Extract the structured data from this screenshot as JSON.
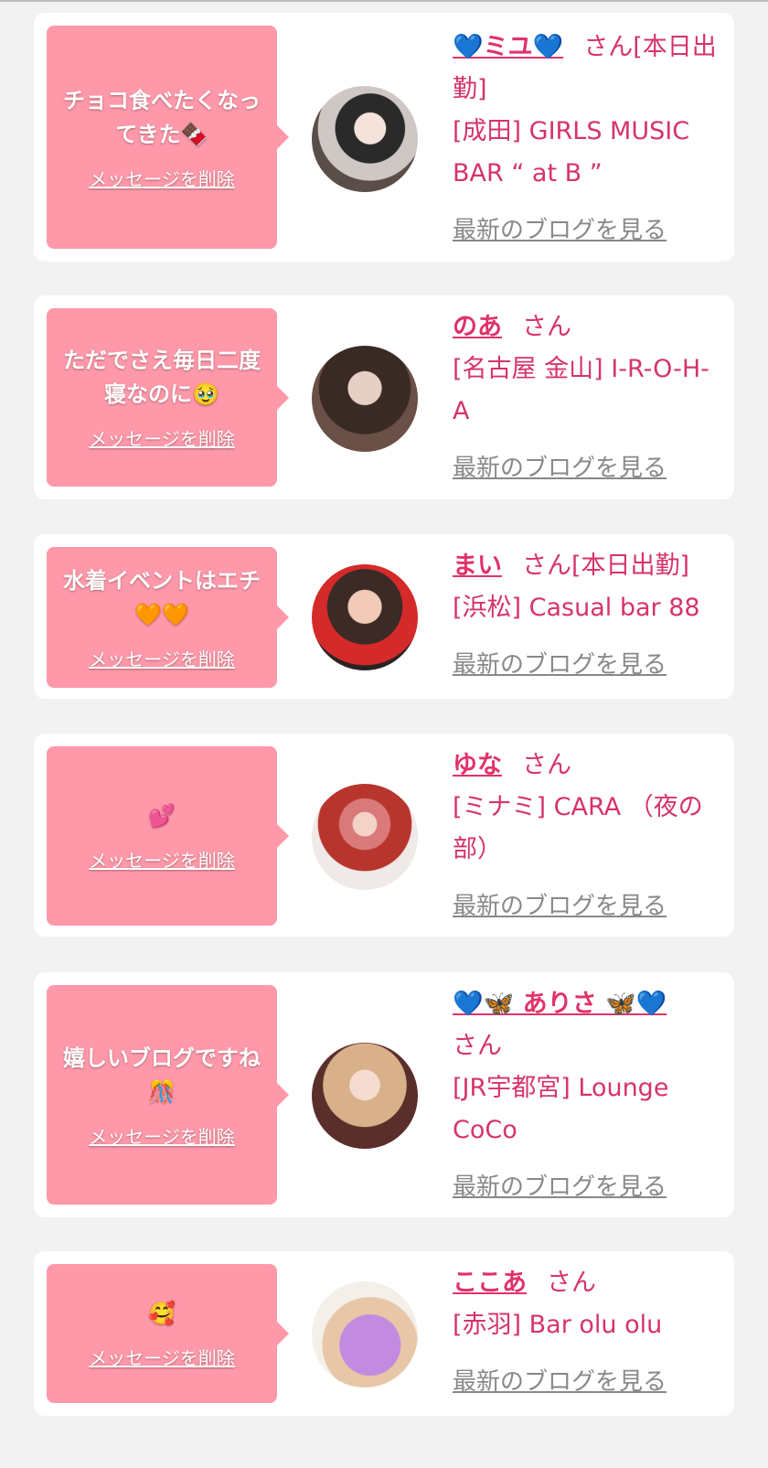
{
  "delete_label": "メッセージを削除",
  "blog_label": "最新のブログを見る",
  "san_label": "さん",
  "cards": [
    {
      "message": "チョコ食べたくなってきた🍫",
      "name": "💙ミユ💙",
      "status": "[本日出勤]",
      "shop": "[成田] GIRLS MUSIC BAR “ at B ”"
    },
    {
      "message": "ただでさえ毎日二度寝なのに🥹",
      "name": "のあ",
      "status": "",
      "shop": "[名古屋 金山] I-R-O-H-A"
    },
    {
      "message": "水着イベントはエチ🧡🧡",
      "name": "まい",
      "status": "[本日出勤]",
      "shop": "[浜松] Casual bar 88"
    },
    {
      "message": "💕",
      "name": "ゆな",
      "status": "",
      "shop": "[ミナミ] CARA （夜の部）"
    },
    {
      "message": "嬉しいブログですね🎊",
      "name": "💙🦋 ありさ 🦋💙",
      "status": "",
      "shop": "[JR宇都宮] Lounge CoCo"
    },
    {
      "message": "🥰",
      "name": "ここあ",
      "status": "",
      "shop": "[赤羽] Bar olu olu"
    }
  ],
  "colors": {
    "bubble": "#ff99aa",
    "name": "#e0336a",
    "text": "#d6336c",
    "link_gray": "#888888",
    "background": "#f2f2f2"
  }
}
